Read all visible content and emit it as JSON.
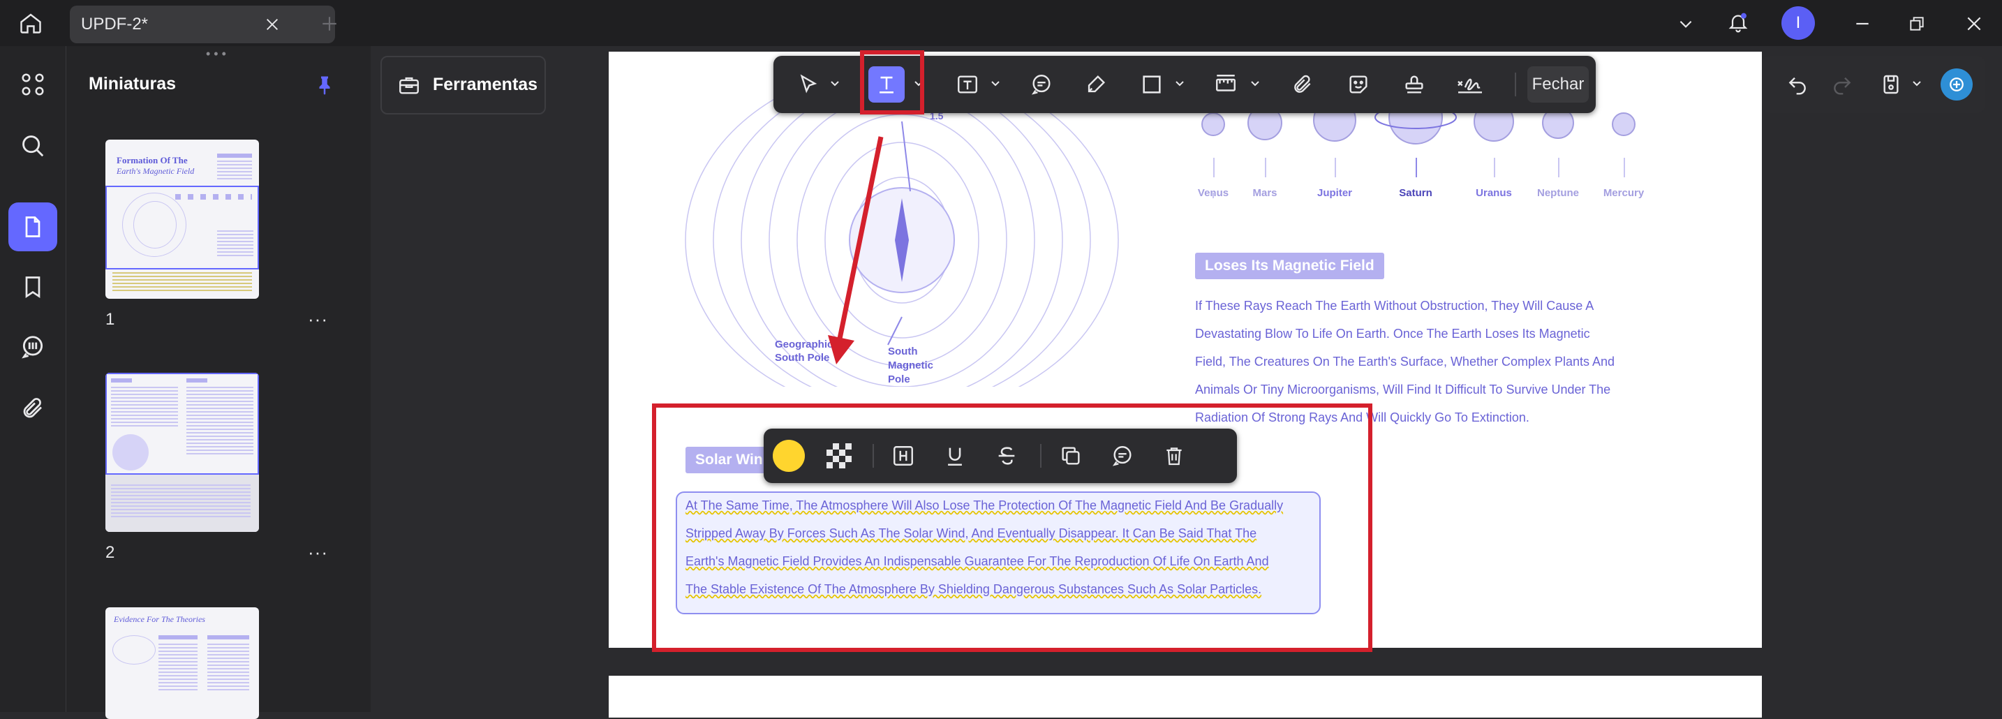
{
  "tab": {
    "title": "UPDF-2*"
  },
  "account": {
    "avatar_initial": "I"
  },
  "thumbnails": {
    "title": "Miniaturas",
    "pages": [
      {
        "label": "1",
        "heading": "Formation Of The",
        "heading2": "Earth's Magnetic Field"
      },
      {
        "label": "2"
      },
      {
        "label": "",
        "heading": "Evidence For The Theories"
      }
    ]
  },
  "tools": {
    "label": "Ferramentas"
  },
  "toolbar": {
    "close_label": "Fechar"
  },
  "page": {
    "annotation": "1.5",
    "poles": {
      "geo_south_1": "Geographic",
      "geo_south_2": "South Pole",
      "mag_south_1": "South",
      "mag_south_2": "Magnetic",
      "mag_south_3": "Pole"
    },
    "planets": [
      "Venus",
      "Mars",
      "Jupiter",
      "Saturn",
      "Uranus",
      "Neptune",
      "Mercury"
    ],
    "section_title": "Loses Its Magnetic Field",
    "section_lines": [
      "If These Rays Reach The Earth Without Obstruction, They Will Cause A",
      "Devastating Blow To Life On Earth. Once The Earth Loses Its Magnetic",
      "Field, The Creatures On The Earth's Surface, Whether Complex Plants And",
      "Animals Or Tiny Microorganisms, Will Find It Difficult To Survive Under The",
      "Radiation Of Strong Rays And Will Quickly Go To Extinction."
    ],
    "solar_title": "Solar Win",
    "solar_lines": [
      "At The Same Time, The Atmosphere Will Also Lose The Protection Of The Magnetic Field And Be Gradually",
      "Stripped Away By Forces Such As The Solar Wind, And Eventually Disappear. It Can Be Said That The",
      "Earth's Magnetic Field Provides An Indispensable Guarantee For The Reproduction Of Life On Earth And",
      "The Stable Existence Of The Atmosphere By Shielding Dangerous Substances Such As Solar Particles."
    ]
  },
  "colors": {
    "accent": "#6468ff",
    "highlight_red": "#d4202c",
    "yellow": "#ffd52e"
  }
}
